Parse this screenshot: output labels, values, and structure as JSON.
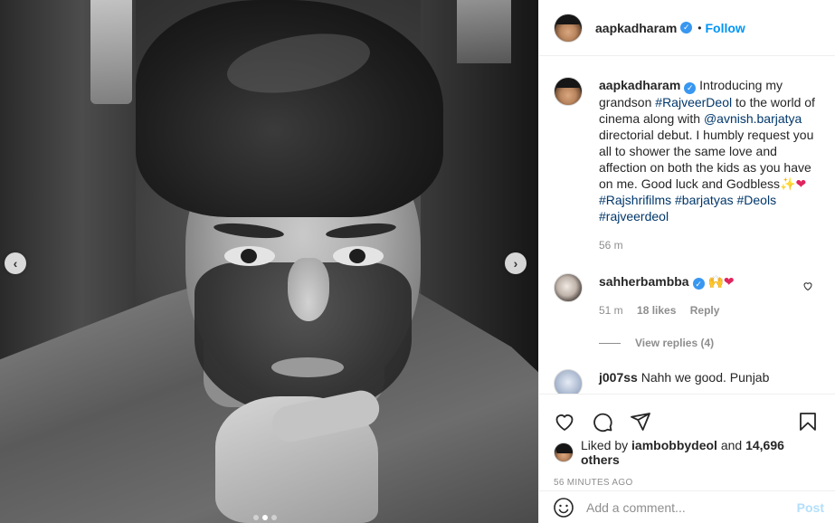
{
  "post": {
    "author": "aapkadharam",
    "follow_separator": "•",
    "follow_label": "Follow",
    "verified_mark": "✓"
  },
  "media": {
    "prev_label": "‹",
    "next_label": "›",
    "slide_count": 3,
    "active_slide": 2
  },
  "caption": {
    "username": "aapkadharam",
    "text_1": "Introducing my grandson ",
    "tag_1": "#RajveerDeol",
    "text_2": " to the world of cinema along with ",
    "mention_1": "@avnish.barjatya",
    "text_3": " directorial debut. I humbly request you all to shower the same love and affection on both the kids as you have on me. Good luck and Godbless",
    "emoji_1": "✨",
    "emoji_2": "❤",
    "tags_line": "#Rajshrifilms #barjatyas #Deols #rajveerdeol",
    "time": "56 m"
  },
  "comments": [
    {
      "username": "sahherbambba",
      "emoji_1": "🙌",
      "emoji_2": "❤",
      "time": "51 m",
      "likes": "18 likes",
      "reply_label": "Reply",
      "view_replies": "View replies (4)"
    },
    {
      "username": "j007ss",
      "text": "Nahh we good. Punjab"
    }
  ],
  "actions": {
    "liked_by_prefix": "Liked by",
    "liked_by_user": "iambobbydeol",
    "liked_by_and": "and",
    "liked_by_count": "14,696 others",
    "timestamp": "56 MINUTES AGO"
  },
  "comment_box": {
    "placeholder": "Add a comment...",
    "post_label": "Post"
  },
  "colors": {
    "link": "#00376b",
    "follow": "#0095f6",
    "verified": "#3897f0",
    "post_disabled": "#b2dffc"
  }
}
